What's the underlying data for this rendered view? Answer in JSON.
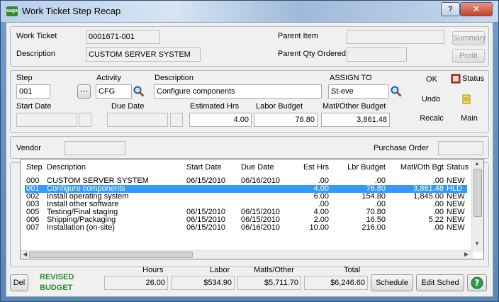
{
  "window": {
    "title": "Work Ticket Step Recap",
    "icon": "sage-icon"
  },
  "header": {
    "work_ticket_label": "Work Ticket",
    "work_ticket_value": "0001671-001",
    "description_label": "Description",
    "description_value": "CUSTOM SERVER SYSTEM",
    "parent_item_label": "Parent Item",
    "parent_item_value": "",
    "parent_qty_label": "Parent Qty Ordered",
    "parent_qty_value": "",
    "summary_button": "Summary",
    "profit_button": "Profit"
  },
  "step": {
    "step_label": "Step",
    "step_value": "001",
    "activity_label": "Activity",
    "activity_value": "CFG",
    "description_label": "Description",
    "description_value": "Configure components",
    "assign_label": "ASSIGN TO",
    "assign_value": "St-eve",
    "start_date_label": "Start Date",
    "start_date_value": "",
    "due_date_label": "Due Date",
    "due_date_value": "",
    "est_hrs_label": "Estimated Hrs",
    "est_hrs_value": "4.00",
    "labor_budget_label": "Labor Budget",
    "labor_budget_value": "76.80",
    "matl_budget_label": "Matl/Other Budget",
    "matl_budget_value": "3,861.48",
    "ok_button": "OK",
    "undo_button": "Undo",
    "recalc_button": "Recalc",
    "status_button": "Status",
    "main_button": "Main"
  },
  "vendor": {
    "vendor_label": "Vendor",
    "vendor_value": "",
    "po_label": "Purchase Order",
    "po_value": ""
  },
  "grid": {
    "columns": [
      "Step",
      "Description",
      "Start Date",
      "Due Date",
      "Est Hrs",
      "Lbr Budget",
      "Matl/Oth Bgt",
      "Status"
    ],
    "rows": [
      [
        "000",
        "CUSTOM SERVER SYSTEM",
        "06/15/2010",
        "06/16/2010",
        ".00",
        ".00",
        ".00",
        "NEW"
      ],
      [
        "001",
        "Configure components",
        "",
        "",
        "4.00",
        "76.80",
        "3,861.48",
        "HLD"
      ],
      [
        "002",
        "Install operating system",
        "",
        "",
        "6.00",
        "154.80",
        "1,845.00",
        "NEW"
      ],
      [
        "003",
        "Install other software",
        "",
        "",
        ".00",
        ".00",
        ".00",
        "NEW"
      ],
      [
        "005",
        "Testing/Final staging",
        "06/15/2010",
        "06/15/2010",
        "4.00",
        "70.80",
        ".00",
        "NEW"
      ],
      [
        "006",
        "Shipping/Packaging",
        "06/15/2010",
        "06/15/2010",
        "2.00",
        "16.50",
        "5.22",
        "NEW"
      ],
      [
        "007",
        "Installation (on-site)",
        "06/15/2010",
        "06/16/2010",
        "10.00",
        "216.00",
        ".00",
        "NEW"
      ]
    ],
    "selected_row": 1
  },
  "totals": {
    "revised_label": "REVISED",
    "budget_label": "BUDGET",
    "hours_label": "Hours",
    "hours_value": "26.00",
    "labor_label": "Labor",
    "labor_value": "$534.90",
    "matls_label": "Matls/Other",
    "matls_value": "$5,711.70",
    "total_label": "Total",
    "total_value": "$6,246.60"
  },
  "buttons": {
    "del": "Del",
    "schedule": "Schedule",
    "edit_sched": "Edit Sched",
    "help": "help-icon"
  },
  "colors": {
    "selection": "#3399ff",
    "green": "#2e8b2e",
    "title_bar": "#b9d0ea"
  }
}
